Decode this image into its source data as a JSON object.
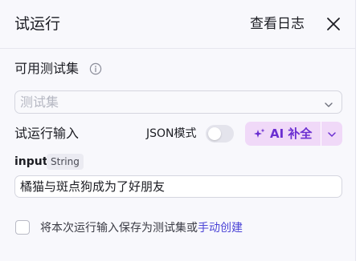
{
  "header": {
    "title": "试运行",
    "log_link": "查看日志",
    "close_icon": "close-icon"
  },
  "test_set": {
    "label": "可用测试集",
    "info_icon": "info-icon",
    "placeholder": "测试集",
    "chevron_icon": "chevron-down-icon"
  },
  "run_input": {
    "label": "试运行输入",
    "json_mode_label": "JSON模式",
    "json_mode_on": false,
    "ai_button": {
      "label": "AI 补全",
      "icon": "sparkle-icon",
      "dropdown_icon": "chevron-down-icon"
    }
  },
  "param": {
    "name": "input",
    "type": "String",
    "value": "橘猫与斑点狗成为了好朋友"
  },
  "save_option": {
    "checked": false,
    "label": "将本次运行输入保存为测试集或",
    "link": "手动创建"
  },
  "colors": {
    "accent": "#6b2fd1",
    "ai_button_bg": "#f0d9f8",
    "link": "#4b44d6"
  }
}
